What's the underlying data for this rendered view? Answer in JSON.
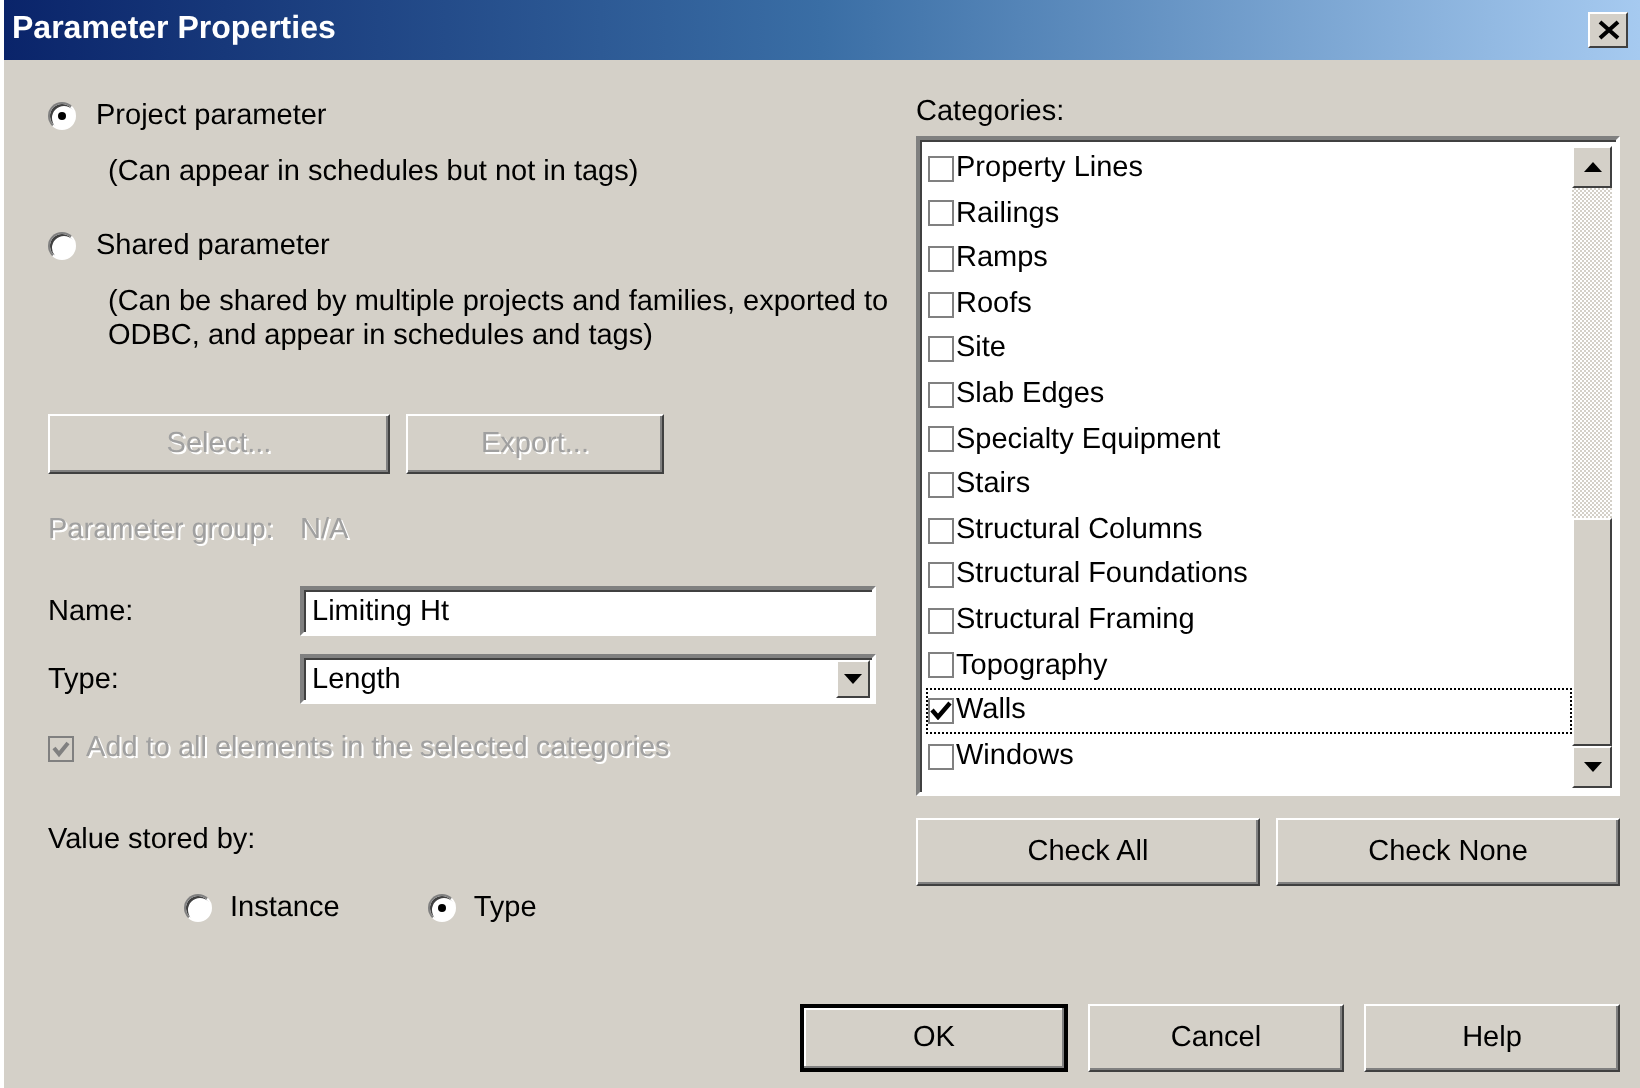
{
  "window": {
    "title": "Parameter Properties"
  },
  "parameter_kind": [
    {
      "label": "Project parameter",
      "description": "(Can appear in schedules but not in tags)",
      "selected": true
    },
    {
      "label": "Shared parameter",
      "description": "(Can be shared by multiple projects and families, exported to ODBC, and appear in schedules and tags)",
      "selected": false
    }
  ],
  "shared_buttons": [
    {
      "label": "Select...",
      "disabled": true
    },
    {
      "label": "Export...",
      "disabled": true
    }
  ],
  "parameter_group": {
    "label": "Parameter group:",
    "value": "N/A",
    "disabled": true
  },
  "name": {
    "label": "Name:",
    "value": "Limiting Ht"
  },
  "type": {
    "label": "Type:",
    "value": "Length"
  },
  "add_to_all": {
    "label": "Add to all elements in the selected categories",
    "checked": true,
    "disabled": true
  },
  "value_stored_by": {
    "label": "Value stored by:",
    "options": [
      {
        "label": "Instance",
        "selected": false
      },
      {
        "label": "Type",
        "selected": true
      }
    ]
  },
  "categories": {
    "label": "Categories:",
    "items": [
      {
        "label": "Property Lines",
        "checked": false,
        "focused": false
      },
      {
        "label": "Railings",
        "checked": false,
        "focused": false
      },
      {
        "label": "Ramps",
        "checked": false,
        "focused": false
      },
      {
        "label": "Roofs",
        "checked": false,
        "focused": false
      },
      {
        "label": "Site",
        "checked": false,
        "focused": false
      },
      {
        "label": "Slab Edges",
        "checked": false,
        "focused": false
      },
      {
        "label": "Specialty Equipment",
        "checked": false,
        "focused": false
      },
      {
        "label": "Stairs",
        "checked": false,
        "focused": false
      },
      {
        "label": "Structural Columns",
        "checked": false,
        "focused": false
      },
      {
        "label": "Structural Foundations",
        "checked": false,
        "focused": false
      },
      {
        "label": "Structural Framing",
        "checked": false,
        "focused": false
      },
      {
        "label": "Topography",
        "checked": false,
        "focused": false
      },
      {
        "label": "Walls",
        "checked": true,
        "focused": true
      },
      {
        "label": "Windows",
        "checked": false,
        "focused": false
      }
    ],
    "buttons": [
      "Check All",
      "Check None"
    ]
  },
  "buttons": [
    {
      "label": "OK",
      "default": true
    },
    {
      "label": "Cancel",
      "default": false
    },
    {
      "label": "Help",
      "default": false
    }
  ]
}
